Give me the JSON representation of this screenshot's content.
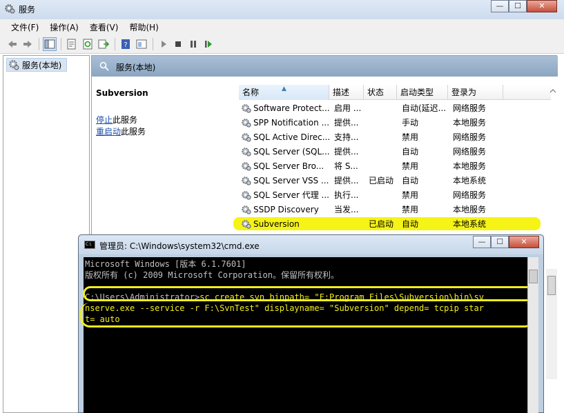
{
  "window": {
    "title": "服务",
    "min": "—",
    "max": "☐",
    "close": "✕"
  },
  "menubar": [
    "文件(F)",
    "操作(A)",
    "查看(V)",
    "帮助(H)"
  ],
  "tree": {
    "root": "服务(本地)"
  },
  "pane": {
    "header": "服务(本地)"
  },
  "ext": {
    "service_name": "Subversion",
    "stop_link": "停止",
    "stop_suffix": "此服务",
    "restart_link": "重启动",
    "restart_suffix": "此服务"
  },
  "columns": [
    "名称",
    "描述",
    "状态",
    "启动类型",
    "登录为"
  ],
  "rows": [
    {
      "name": "Software Protect...",
      "desc": "启用 ...",
      "status": "",
      "start": "自动(延迟...",
      "logon": "网络服务"
    },
    {
      "name": "SPP Notification ...",
      "desc": "提供...",
      "status": "",
      "start": "手动",
      "logon": "本地服务"
    },
    {
      "name": "SQL Active Direc...",
      "desc": "支持...",
      "status": "",
      "start": "禁用",
      "logon": "网络服务"
    },
    {
      "name": "SQL Server (SQL...",
      "desc": "提供...",
      "status": "",
      "start": "自动",
      "logon": "网络服务"
    },
    {
      "name": "SQL Server Bro...",
      "desc": "将 S...",
      "status": "",
      "start": "禁用",
      "logon": "本地服务"
    },
    {
      "name": "SQL Server VSS ...",
      "desc": "提供...",
      "status": "已启动",
      "start": "自动",
      "logon": "本地系统"
    },
    {
      "name": "SQL Server 代理 ...",
      "desc": "执行...",
      "status": "",
      "start": "禁用",
      "logon": "网络服务"
    },
    {
      "name": "SSDP Discovery",
      "desc": "当发...",
      "status": "",
      "start": "禁用",
      "logon": "本地服务"
    },
    {
      "name": "Subversion",
      "desc": "",
      "status": "已启动",
      "start": "自动",
      "logon": "本地系统"
    }
  ],
  "cmd": {
    "title": "管理员: C:\\Windows\\system32\\cmd.exe",
    "lines": [
      "Microsoft Windows [版本 6.1.7601]",
      "版权所有 (c) 2009 Microsoft Corporation。保留所有权利。",
      "",
      "C:\\Users\\Administrator>"
    ],
    "command_1": "sc create svn binpath= \"F:Program Files\\Subversion\\bin\\sv",
    "command_2": "nserve.exe --service -r F:\\SvnTest\" displayname= \"Subversion\" depend= tcpip star",
    "command_3": "t= auto"
  }
}
